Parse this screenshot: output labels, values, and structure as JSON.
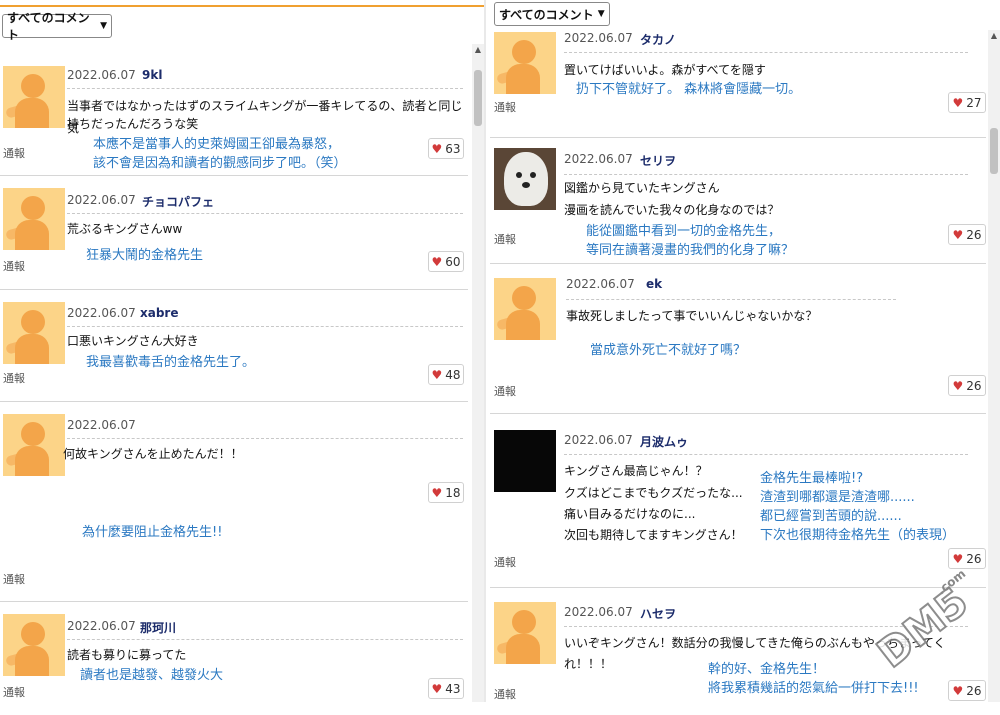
{
  "sort_label": "すべてのコメント",
  "report_label": "通報",
  "left_comments": [
    {
      "date": "2022.06.07",
      "user": "9kl",
      "text": [
        "当事者ではなかったはずのスライムキングが一番キレてるの、読者と同じ気",
        "持ちだったんだろうな笑"
      ],
      "translation": "本應不是當事人的史萊姆國王卻最為暴怒，\n該不會是因為和讀者的觀感同步了吧。（笑）",
      "likes": "63"
    },
    {
      "date": "2022.06.07",
      "user": "チョコパフェ",
      "text": [
        "荒ぶるキングさんww"
      ],
      "translation": "狂暴大鬧的金格先生",
      "likes": "60"
    },
    {
      "date": "2022.06.07",
      "user": "xabre",
      "text": [
        "口悪いキングさん大好き"
      ],
      "translation": "我最喜歡毒舌的金格先生了。",
      "likes": "48"
    },
    {
      "date": "2022.06.07",
      "user": "",
      "text": [
        "何故キングさんを止めたんだ！！"
      ],
      "translation": "為什麼要阻止金格先生!!",
      "likes": "18"
    },
    {
      "date": "2022.06.07",
      "user": "那珂川",
      "text": [
        "読者も募りに募ってた"
      ],
      "translation": "讀者也是越發、越發火大",
      "likes": "43"
    }
  ],
  "right_comments": [
    {
      "date": "2022.06.07",
      "user": "タカノ",
      "text": [
        "置いてけばいいよ。森がすべてを隠す"
      ],
      "translation": "扔下不管就好了。 森林將會隱藏一切。",
      "likes": "27"
    },
    {
      "date": "2022.06.07",
      "user": "セリヲ",
      "text": [
        "図鑑から見ていたキングさん",
        "漫画を読んでいた我々の化身なのでは？"
      ],
      "translation": "能從圖鑑中看到一切的金格先生，\n等同在讀著漫畫的我們的化身了嘛？",
      "likes": "26"
    },
    {
      "date": "2022.06.07",
      "user": "ek",
      "text": [
        "事故死しましたって事でいいんじゃないかな？"
      ],
      "translation": "當成意外死亡不就好了嗎？",
      "likes": "26"
    },
    {
      "date": "2022.06.07",
      "user": "月波ムゥ",
      "text": [
        "キングさん最高じゃん！？",
        "クズはどこまでもクズだったな...",
        "痛い目みるだけなのに...",
        "次回も期待してますキングさん！"
      ],
      "translation": "金格先生最棒啦!?\n渣渣到哪都還是渣渣哪......\n都已經嘗到苦頭的說......\n下次也很期待金格先生（的表現）",
      "likes": "26"
    },
    {
      "date": "2022.06.07",
      "user": "ハセヲ",
      "text": [
        "いいぞキングさん！数話分の我慢してきた俺らのぶんもやっちまってく",
        "れ！！！"
      ],
      "translation": "幹的好、金格先生！\n將我累積幾話的怨氣給一併打下去!!!",
      "likes": "26"
    }
  ],
  "watermark": "DM5",
  "watermark_sub": ".com"
}
